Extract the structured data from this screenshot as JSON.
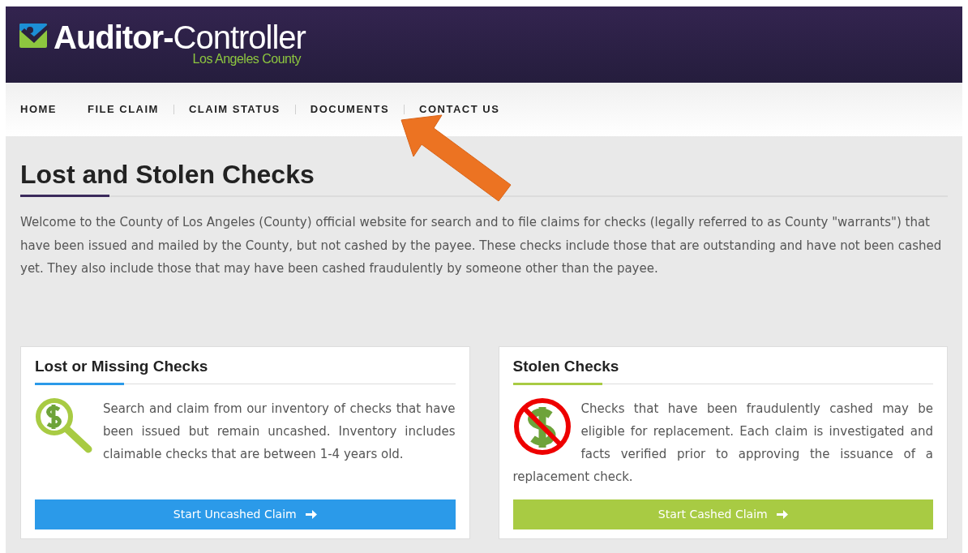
{
  "header": {
    "logo_text": "**Auditor-**Controller",
    "logo_subtitle": "Los Angeles County"
  },
  "nav": [
    {
      "label": "HOME",
      "divider_before": false
    },
    {
      "label": "FILE CLAIM",
      "divider_before": false
    },
    {
      "label": "CLAIM STATUS",
      "divider_before": true
    },
    {
      "label": "DOCUMENTS",
      "divider_before": true
    },
    {
      "label": "CONTACT US",
      "divider_before": true
    }
  ],
  "page": {
    "title": "Lost and Stolen Checks",
    "intro": "Welcome to the County of Los Angeles (County) official website for search and to file claims for checks (legally referred to as County \"warrants\") that have been issued and mailed by the County, but not cashed by the payee.  These checks include those that are outstanding and have not been cashed yet.  They also include those that may have been cashed fraudulently by someone other than the payee."
  },
  "cards": [
    {
      "title": "Lost or Missing Checks",
      "kind": "search",
      "color": "#2b9ae9",
      "text": "Search and claim from our inventory of checks that have been issued but remain uncashed. Inventory includes claimable checks that are between 1-4 years old.",
      "button": "Start Uncashed Claim"
    },
    {
      "title": "Stolen Checks",
      "kind": "prohibited",
      "color": "#a8cb43",
      "text": "Checks that have been fraudulently cashed may be eligible for replacement. Each claim is investigated and facts verified prior to approving the issuance of a replacement check.",
      "button": "Start Cashed Claim"
    }
  ]
}
